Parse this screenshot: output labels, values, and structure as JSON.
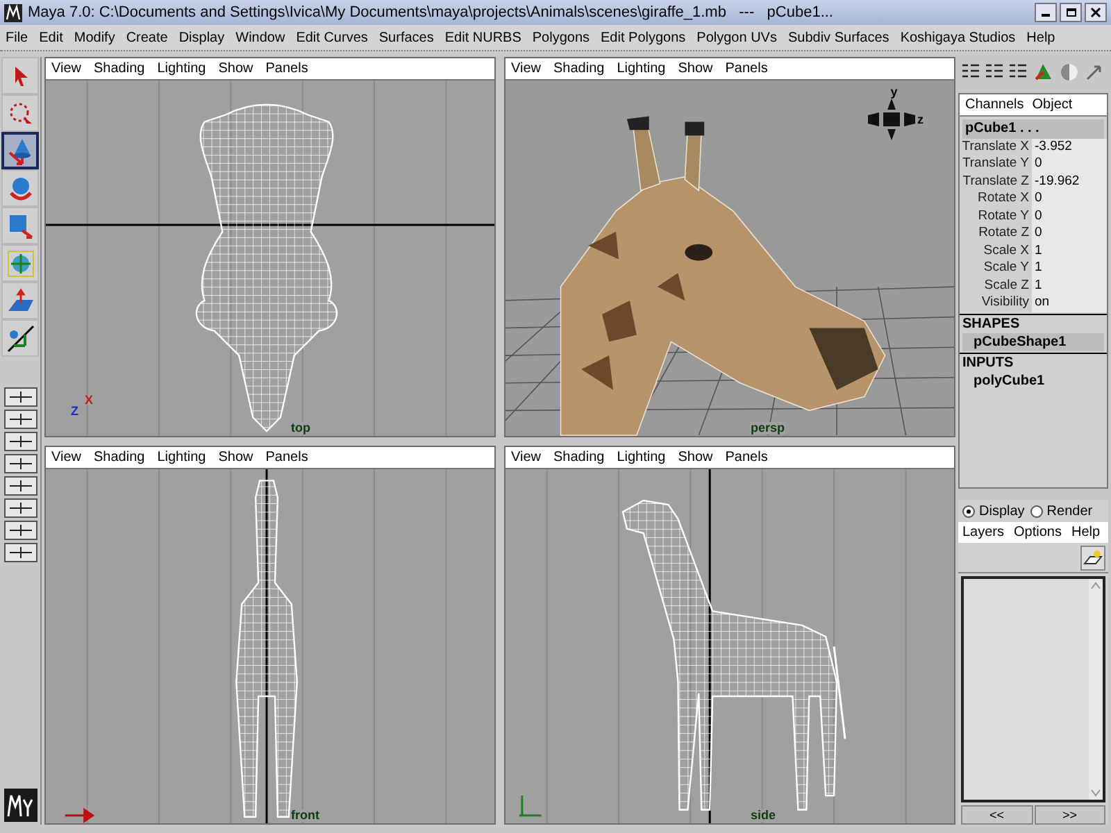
{
  "window": {
    "title": "Maya 7.0: C:\\Documents and Settings\\Ivica\\My Documents\\maya\\projects\\Animals\\scenes\\giraffe_1.mb   ---   pCube1..."
  },
  "menu": [
    "File",
    "Edit",
    "Modify",
    "Create",
    "Display",
    "Window",
    "Edit Curves",
    "Surfaces",
    "Edit NURBS",
    "Polygons",
    "Edit Polygons",
    "Polygon UVs",
    "Subdiv Surfaces",
    "Koshigaya Studios",
    "Help"
  ],
  "tools": [
    {
      "kind": "select",
      "selected": false
    },
    {
      "kind": "lasso",
      "selected": false
    },
    {
      "kind": "move",
      "selected": true
    },
    {
      "kind": "rotate",
      "selected": false
    },
    {
      "kind": "scale",
      "selected": false
    },
    {
      "kind": "universal",
      "selected": false
    },
    {
      "kind": "softmod",
      "selected": false
    },
    {
      "kind": "manip",
      "selected": false
    }
  ],
  "viewports": [
    {
      "kind": "top",
      "label": "top",
      "menu": [
        "View",
        "Shading",
        "Lighting",
        "Show",
        "Panels"
      ],
      "axes": [
        "X",
        "Z"
      ]
    },
    {
      "kind": "persp",
      "label": "persp",
      "menu": [
        "View",
        "Shading",
        "Lighting",
        "Show",
        "Panels"
      ],
      "axes": [
        "y",
        "z"
      ]
    },
    {
      "kind": "front",
      "label": "front",
      "menu": [
        "View",
        "Shading",
        "Lighting",
        "Show",
        "Panels"
      ]
    },
    {
      "kind": "side",
      "label": "side",
      "menu": [
        "View",
        "Shading",
        "Lighting",
        "Show",
        "Panels"
      ]
    }
  ],
  "channel_box": {
    "tabs": [
      "Channels",
      "Object"
    ],
    "object": "pCube1 . . .",
    "attributes": [
      {
        "name": "Translate X",
        "value": "-3.952"
      },
      {
        "name": "Translate Y",
        "value": "0"
      },
      {
        "name": "Translate Z",
        "value": "-19.962"
      },
      {
        "name": "Rotate X",
        "value": "0"
      },
      {
        "name": "Rotate Y",
        "value": "0"
      },
      {
        "name": "Rotate Z",
        "value": "0"
      },
      {
        "name": "Scale X",
        "value": "1"
      },
      {
        "name": "Scale Y",
        "value": "1"
      },
      {
        "name": "Scale Z",
        "value": "1"
      },
      {
        "name": "Visibility",
        "value": "on"
      }
    ],
    "shapes_header": "SHAPES",
    "shape": "pCubeShape1",
    "inputs_header": "INPUTS",
    "input": "polyCube1"
  },
  "layer_editor": {
    "modes": [
      {
        "label": "Display",
        "selected": true
      },
      {
        "label": "Render",
        "selected": false
      }
    ],
    "menu": [
      "Layers",
      "Options",
      "Help"
    ],
    "nav": [
      "<<",
      ">>"
    ]
  }
}
